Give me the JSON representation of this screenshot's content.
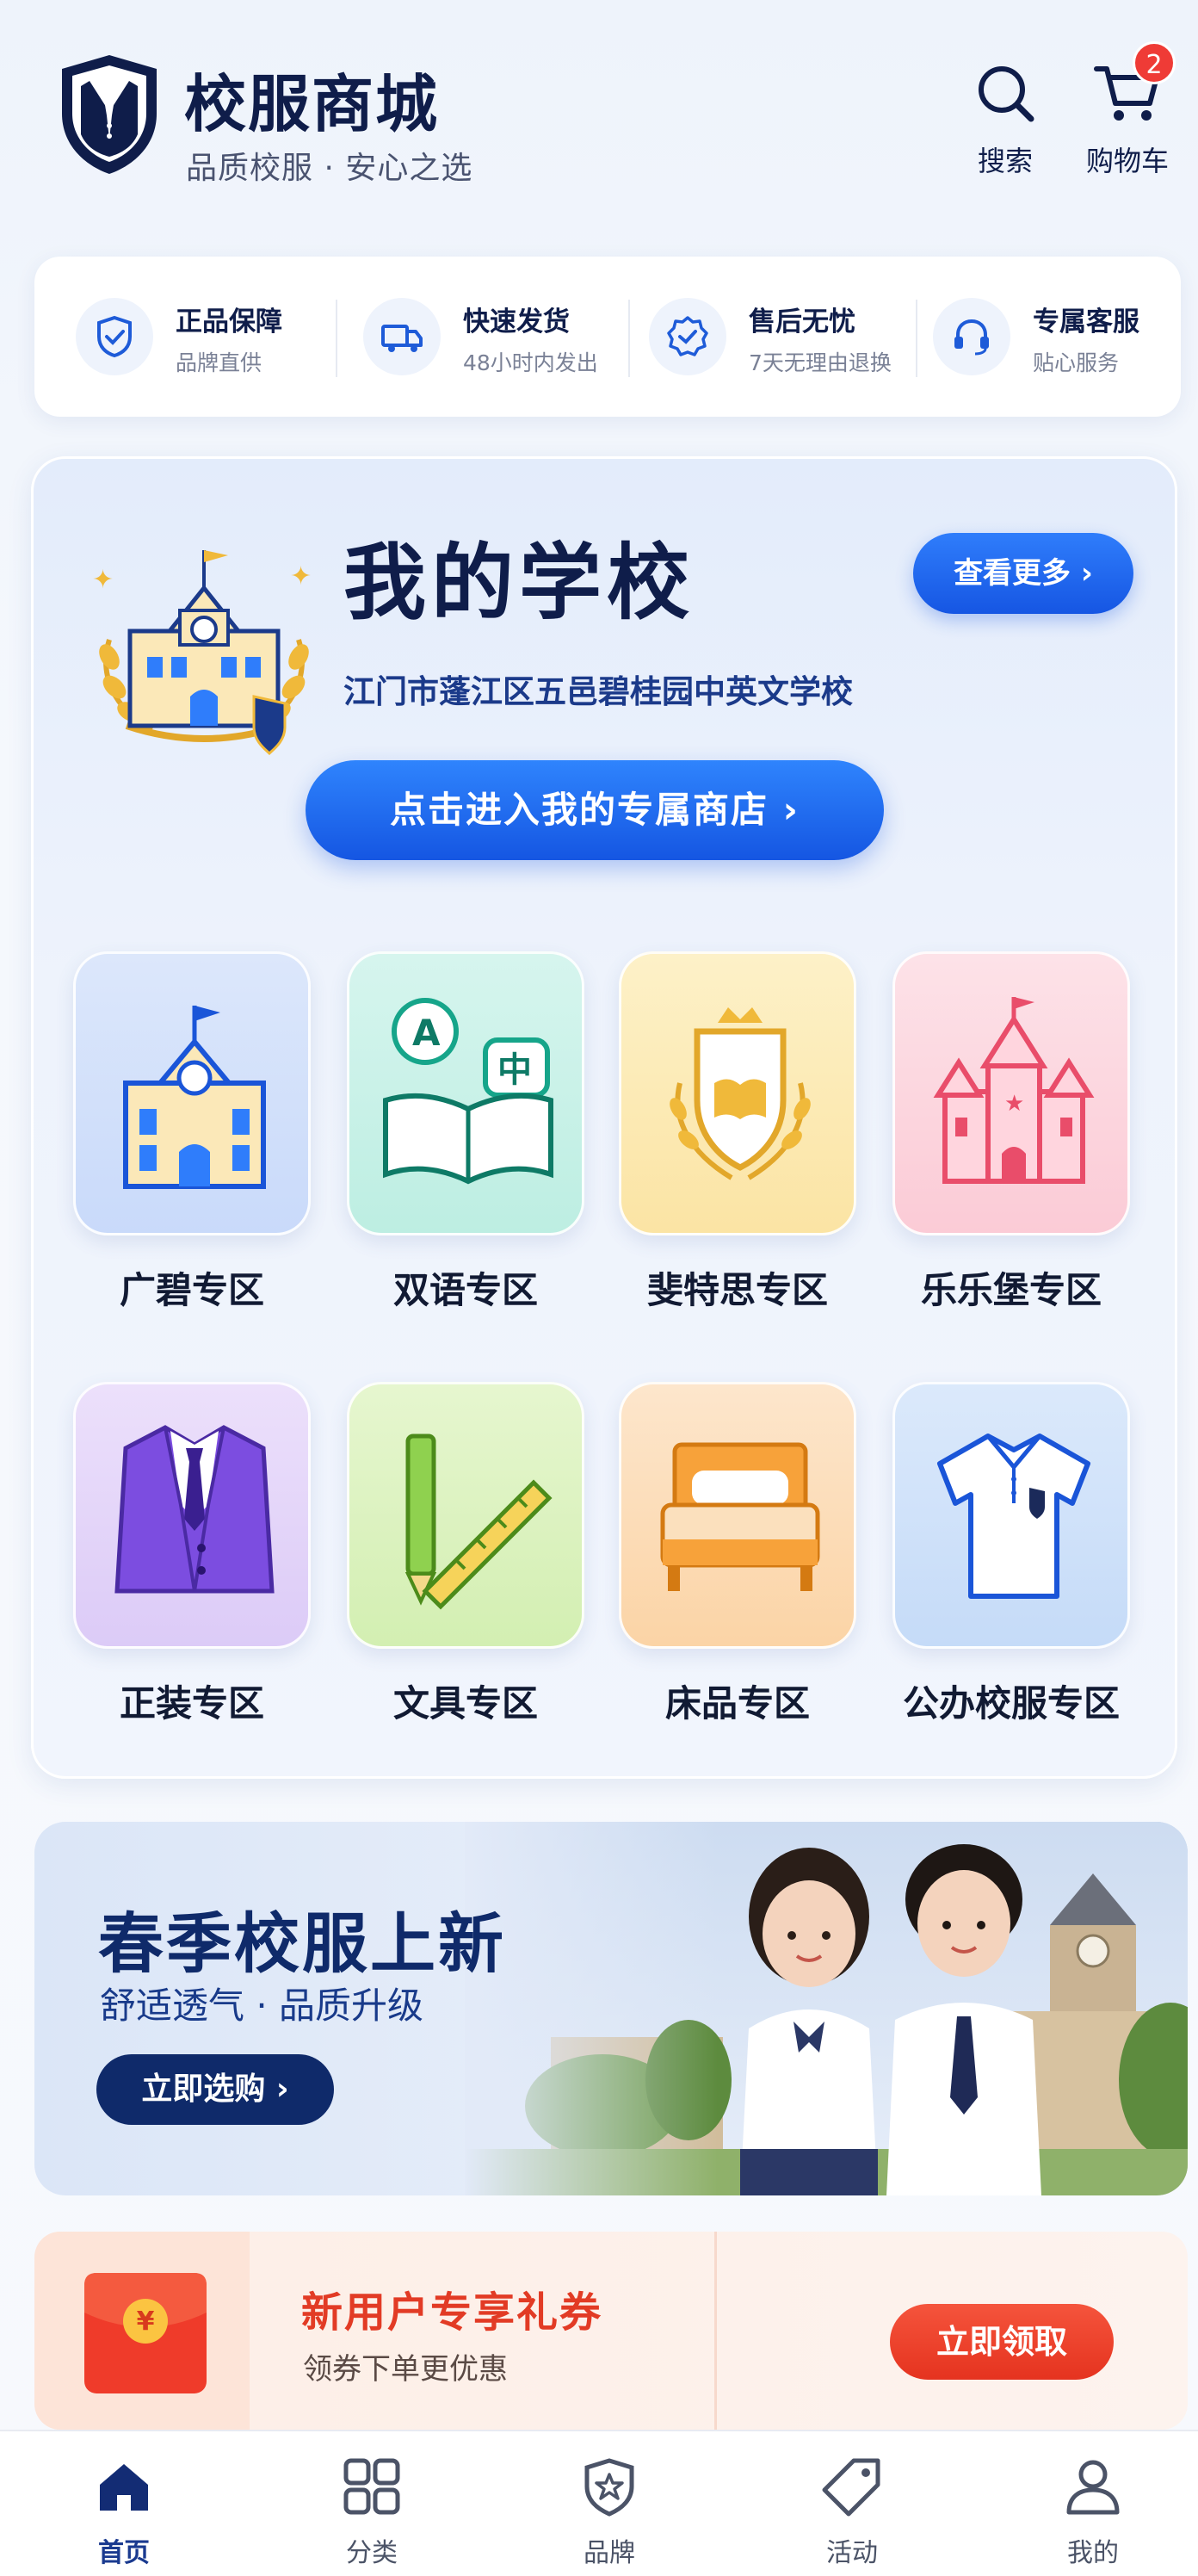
{
  "header": {
    "app_title": "校服商城",
    "app_subtitle": "品质校服 · 安心之选",
    "search_label": "搜索",
    "cart_label": "购物车",
    "cart_count": "2"
  },
  "services": [
    {
      "title": "正品保障",
      "subtitle": "品牌直供",
      "icon": "shield-check-icon"
    },
    {
      "title": "快速发货",
      "subtitle": "48小时内发出",
      "icon": "truck-icon"
    },
    {
      "title": "售后无忧",
      "subtitle": "7天无理由退换",
      "icon": "badge-check-icon"
    },
    {
      "title": "专属客服",
      "subtitle": "贴心服务",
      "icon": "headset-icon"
    }
  ],
  "school": {
    "title": "我的学校",
    "more_label": "查看更多 ›",
    "name": "江门市蓬江区五邑碧桂园中英文学校",
    "enter_label": "点击进入我的专属商店 ›"
  },
  "zones": [
    {
      "label": "广碧专区",
      "icon": "school-building-icon"
    },
    {
      "label": "双语专区",
      "icon": "bilingual-book-icon"
    },
    {
      "label": "斐特思专区",
      "icon": "crest-book-icon"
    },
    {
      "label": "乐乐堡专区",
      "icon": "castle-icon"
    },
    {
      "label": "正装专区",
      "icon": "suit-icon"
    },
    {
      "label": "文具专区",
      "icon": "stationery-icon"
    },
    {
      "label": "床品专区",
      "icon": "bed-icon"
    },
    {
      "label": "公办校服专区",
      "icon": "polo-shirt-icon"
    }
  ],
  "banner": {
    "title": "春季校服上新",
    "subtitle": "舒适透气 · 品质升级",
    "button_label": "立即选购 ›"
  },
  "coupon": {
    "title": "新用户专享礼券",
    "subtitle": "领券下单更优惠",
    "button_label": "立即领取",
    "symbol": "¥"
  },
  "nav": [
    {
      "label": "首页",
      "icon": "home-icon",
      "active": true
    },
    {
      "label": "分类",
      "icon": "grid-icon",
      "active": false
    },
    {
      "label": "品牌",
      "icon": "brand-shield-icon",
      "active": false
    },
    {
      "label": "活动",
      "icon": "tag-icon",
      "active": false
    },
    {
      "label": "我的",
      "icon": "user-icon",
      "active": false
    }
  ],
  "colors": {
    "primary": "#1656e3",
    "navy": "#0f1d4a",
    "accent_red": "#e23b25"
  }
}
